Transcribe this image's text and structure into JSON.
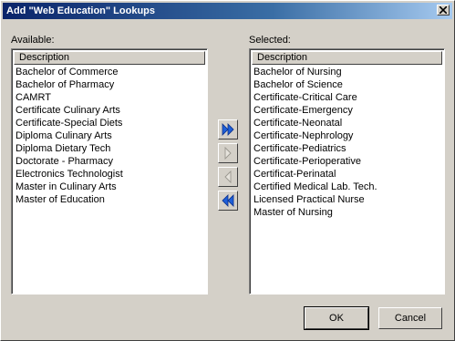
{
  "window": {
    "title": "Add \"Web Education\" Lookups"
  },
  "available": {
    "label": "Available:",
    "header": "Description",
    "items": [
      "Bachelor of Commerce",
      "Bachelor of Pharmacy",
      "CAMRT",
      "Certificate Culinary Arts",
      "Certificate-Special Diets",
      "Diploma Culinary Arts",
      "Diploma Dietary Tech",
      "Doctorate - Pharmacy",
      "Electronics Technologist",
      "Master in Culinary Arts",
      "Master of Education"
    ]
  },
  "selected": {
    "label": "Selected:",
    "header": "Description",
    "items": [
      "Bachelor of Nursing",
      "Bachelor of Science",
      "Certificate-Critical Care",
      "Certificate-Emergency",
      "Certificate-Neonatal",
      "Certificate-Nephrology",
      "Certificate-Pediatrics",
      "Certificate-Perioperative",
      "Certificat-Perinatal",
      "Certified Medical Lab. Tech.",
      "Licensed Practical Nurse",
      "Master of Nursing"
    ]
  },
  "buttons": {
    "ok": "OK",
    "cancel": "Cancel"
  },
  "colors": {
    "titlebar_start": "#0a246a",
    "titlebar_end": "#a6caf0",
    "arrow_active": "#1e5fd8",
    "face": "#d4d0c8"
  },
  "icons": [
    "close-icon",
    "double-right-arrow-icon",
    "right-arrow-icon",
    "left-arrow-icon",
    "double-left-arrow-icon"
  ]
}
